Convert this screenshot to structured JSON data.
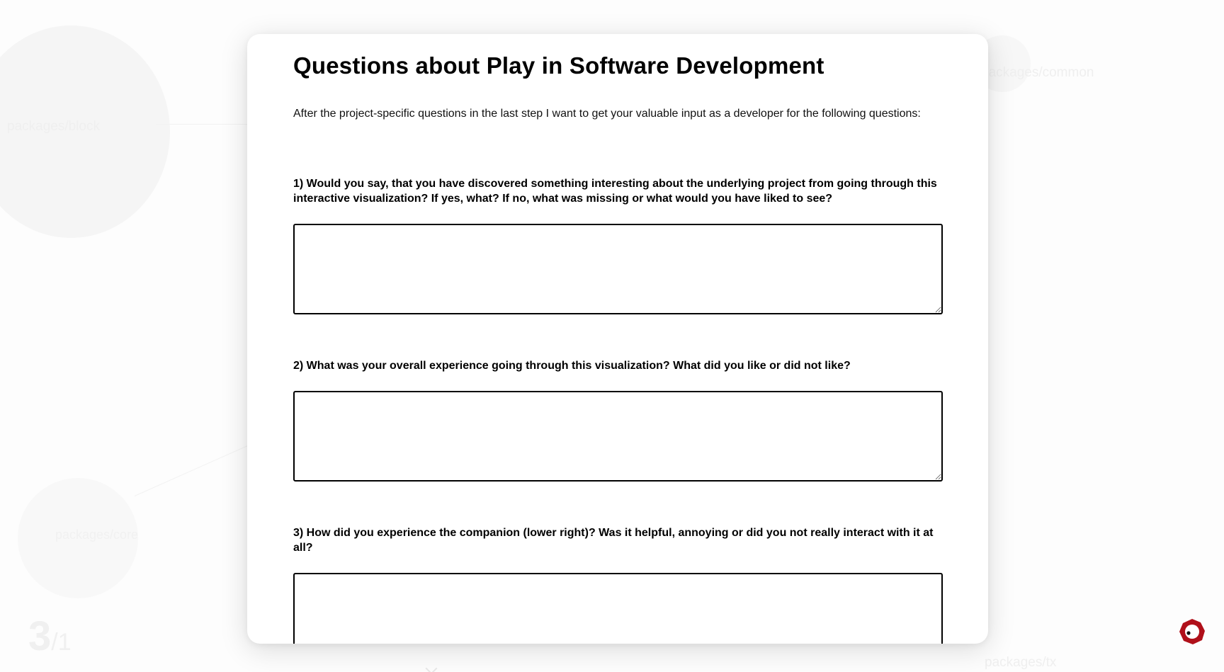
{
  "background": {
    "node_labels": [
      "packages/block",
      "packages/common",
      "packages/core",
      "packages/tx"
    ],
    "step_counter": {
      "current": "3",
      "total": "/1"
    }
  },
  "dialog": {
    "title": "Questions about Play in Software Development",
    "intro": "After the project-specific questions in the last step I want to get your valuable input as a developer for the following questions:",
    "questions": [
      {
        "label": "1) Would you say, that you have discovered something interesting about the underlying project from going through this interactive visualization? If yes, what? If no, what was missing or what would you have liked to see?",
        "value": ""
      },
      {
        "label": "2) What was your overall experience going through this visualization? What did you like or did not like?",
        "value": ""
      },
      {
        "label": "3) How did you experience the companion (lower right)? Was it helpful, annoying or did you not really interact with it at all?",
        "value": ""
      }
    ]
  },
  "companion": {
    "icon": "companion-icon",
    "color": "#b0101a"
  },
  "colors": {
    "accent": "#b0101a",
    "border": "#000000",
    "background": "#ffffff"
  }
}
